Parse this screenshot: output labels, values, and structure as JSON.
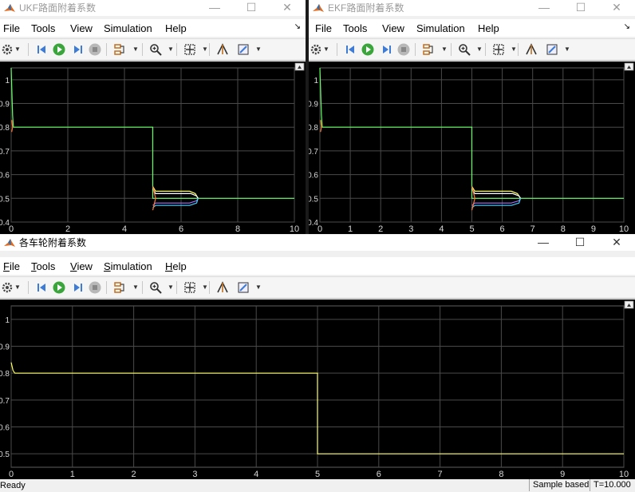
{
  "windows": {
    "ukf": {
      "title": "UKF路面附着系数",
      "active": false,
      "menu": [
        {
          "label": "File",
          "u": "",
          "rest": "File"
        },
        {
          "label": "Tools",
          "u": "",
          "rest": "Tools"
        },
        {
          "label": "View",
          "u": "",
          "rest": "View"
        },
        {
          "label": "Simulation",
          "u": "",
          "rest": "Simulation"
        },
        {
          "label": "Help",
          "u": "",
          "rest": "Help"
        }
      ]
    },
    "ekf": {
      "title": "EKF路面附着系数",
      "active": false
    },
    "wheels": {
      "title": "各车轮附着系数",
      "active": true
    }
  },
  "menu_labels": {
    "file": "File",
    "tools": "Tools",
    "view": "View",
    "simulation": "Simulation",
    "help": "Help"
  },
  "menu_underline": {
    "file_u": "F",
    "file_rest": "ile",
    "tools_u": "T",
    "tools_rest": "ools",
    "view_u": "V",
    "view_rest": "iew",
    "simulation_u": "S",
    "simulation_rest": "imulation",
    "help_u": "H",
    "help_rest": "elp"
  },
  "caption": {
    "minimize": "—",
    "maximize": "☐",
    "close": "✕"
  },
  "toolbar_icons": [
    "gear-icon",
    "step-back-icon",
    "run-icon",
    "step-forward-icon",
    "stop-icon",
    "highlight-icon",
    "zoom-icon",
    "fit-icon",
    "restore-icon",
    "measure-icon"
  ],
  "colors": {
    "plot_bg": "#000000",
    "grid": "#4a4a4a",
    "tick": "#d8d8d8",
    "yellow": "#ffff66",
    "green": "#66ff66",
    "cyan": "#44d0ff",
    "orange": "#ff7733",
    "purple": "#a070ff",
    "white": "#ffffff",
    "blue": "#4a8cff"
  },
  "status": {
    "ready": "Ready",
    "sample": "Sample based",
    "time": "T=10.000"
  },
  "chart_data": [
    {
      "type": "line",
      "name": "UKF路面附着系数",
      "xlim": [
        0,
        10
      ],
      "ylim": [
        0.4,
        1.05
      ],
      "xticks": [
        0,
        2,
        4,
        6,
        8,
        10
      ],
      "yticks": [
        0.4,
        0.5,
        0.6,
        0.7,
        0.8,
        0.9,
        1
      ],
      "ytick_labels": [
        "0.4",
        "0.5",
        "0.6",
        "0.7",
        "0.8",
        "0.9",
        "1"
      ],
      "xtick_labels": [
        "0",
        "2",
        "4",
        "6",
        "8",
        "10"
      ],
      "grid": true,
      "series": [
        {
          "color_key": "green",
          "x": [
            0,
            0.05,
            0.08,
            5.0,
            5.0,
            10
          ],
          "y": [
            1.05,
            0.85,
            0.8,
            0.8,
            0.5,
            0.5
          ]
        },
        {
          "color_key": "yellow",
          "x": [
            5.0,
            5.1,
            6.3,
            6.5,
            6.6
          ],
          "y": [
            0.55,
            0.53,
            0.53,
            0.52,
            0.5
          ]
        },
        {
          "color_key": "white",
          "x": [
            5.0,
            5.1,
            6.35,
            6.55,
            6.6
          ],
          "y": [
            0.54,
            0.52,
            0.52,
            0.51,
            0.5
          ]
        },
        {
          "color_key": "purple",
          "x": [
            5.0,
            5.1,
            6.3,
            6.55,
            6.6
          ],
          "y": [
            0.47,
            0.48,
            0.48,
            0.49,
            0.5
          ]
        },
        {
          "color_key": "cyan",
          "x": [
            5.0,
            5.1,
            6.3,
            6.55,
            6.6
          ],
          "y": [
            0.46,
            0.47,
            0.47,
            0.48,
            0.5
          ]
        },
        {
          "color_key": "orange",
          "x": [
            5.0,
            5.1,
            5.0
          ],
          "y": [
            0.55,
            0.5,
            0.45
          ]
        },
        {
          "color_key": "orange",
          "x": [
            0.02,
            0.05,
            0.02
          ],
          "y": [
            0.83,
            0.8,
            0.78
          ]
        }
      ]
    },
    {
      "type": "line",
      "name": "EKF路面附着系数",
      "xlim": [
        0,
        10
      ],
      "ylim": [
        0.4,
        1.05
      ],
      "xticks": [
        0,
        1,
        2,
        3,
        4,
        5,
        6,
        7,
        8,
        9,
        10
      ],
      "yticks": [
        0.4,
        0.5,
        0.6,
        0.7,
        0.8,
        0.9,
        1
      ],
      "ytick_labels": [
        "0.4",
        "0.5",
        "0.6",
        "0.7",
        "0.8",
        "0.9",
        "1"
      ],
      "xtick_labels": [
        "0",
        "1",
        "2",
        "3",
        "4",
        "5",
        "6",
        "7",
        "8",
        "9",
        "10"
      ],
      "grid": true,
      "series": [
        {
          "color_key": "green",
          "x": [
            0,
            0.05,
            0.08,
            5.0,
            5.0,
            10
          ],
          "y": [
            1.05,
            0.85,
            0.8,
            0.8,
            0.5,
            0.5
          ]
        },
        {
          "color_key": "yellow",
          "x": [
            5.0,
            5.1,
            6.3,
            6.5,
            6.6
          ],
          "y": [
            0.55,
            0.53,
            0.53,
            0.52,
            0.5
          ]
        },
        {
          "color_key": "white",
          "x": [
            5.0,
            5.1,
            6.35,
            6.55,
            6.6
          ],
          "y": [
            0.54,
            0.52,
            0.52,
            0.51,
            0.5
          ]
        },
        {
          "color_key": "purple",
          "x": [
            5.0,
            5.1,
            6.3,
            6.55,
            6.6
          ],
          "y": [
            0.47,
            0.48,
            0.48,
            0.49,
            0.5
          ]
        },
        {
          "color_key": "cyan",
          "x": [
            5.0,
            5.1,
            6.3,
            6.55,
            6.6
          ],
          "y": [
            0.46,
            0.47,
            0.47,
            0.48,
            0.5
          ]
        },
        {
          "color_key": "orange",
          "x": [
            5.0,
            5.1,
            5.0
          ],
          "y": [
            0.55,
            0.5,
            0.45
          ]
        },
        {
          "color_key": "orange",
          "x": [
            0.02,
            0.05,
            0.02
          ],
          "y": [
            0.83,
            0.8,
            0.78
          ]
        }
      ]
    },
    {
      "type": "line",
      "name": "各车轮附着系数",
      "xlim": [
        0,
        10
      ],
      "ylim": [
        0.45,
        1.05
      ],
      "xticks": [
        0,
        1,
        2,
        3,
        4,
        5,
        6,
        7,
        8,
        9,
        10
      ],
      "yticks": [
        0.5,
        0.6,
        0.7,
        0.8,
        0.9,
        1
      ],
      "ytick_labels": [
        "0.5",
        "0.6",
        "0.7",
        "0.8",
        "0.9",
        "1"
      ],
      "xtick_labels": [
        "0",
        "1",
        "2",
        "3",
        "4",
        "5",
        "6",
        "7",
        "8",
        "9",
        "10"
      ],
      "grid": true,
      "series": [
        {
          "color_key": "yellow",
          "x": [
            0,
            0.03,
            0.06,
            5.0,
            5.0,
            10
          ],
          "y": [
            0.84,
            0.81,
            0.8,
            0.8,
            0.5,
            0.5
          ]
        }
      ]
    }
  ]
}
